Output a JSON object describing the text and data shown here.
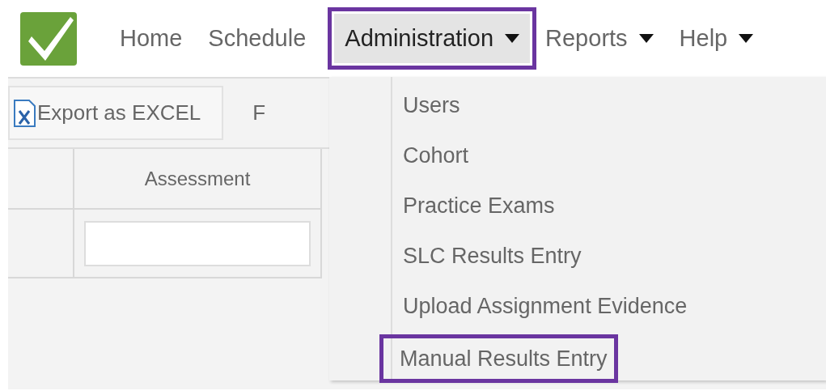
{
  "nav": [
    {
      "label": "Home",
      "has_menu": false,
      "open": false,
      "highlighted": false
    },
    {
      "label": "Schedule",
      "has_menu": false,
      "open": false,
      "highlighted": false
    },
    {
      "label": "Administration",
      "has_menu": true,
      "open": true,
      "highlighted": true
    },
    {
      "label": "Reports",
      "has_menu": true,
      "open": false,
      "highlighted": false
    },
    {
      "label": "Help",
      "has_menu": true,
      "open": false,
      "highlighted": false
    }
  ],
  "toolbar": [
    {
      "kind": "button",
      "label": "Export as EXCEL"
    },
    {
      "kind": "text",
      "label": "F"
    }
  ],
  "table": {
    "columns": [
      {
        "kind": "blank",
        "filter": false
      },
      {
        "kind": "text",
        "label": "Assessment",
        "filter": true
      }
    ]
  },
  "dropdown": {
    "items": [
      {
        "label": "Users",
        "highlighted": false
      },
      {
        "label": "Cohort",
        "highlighted": false
      },
      {
        "label": "Practice Exams",
        "highlighted": false
      },
      {
        "label": "SLC Results Entry",
        "highlighted": false
      },
      {
        "label": "Upload Assignment Evidence",
        "highlighted": false
      },
      {
        "label": "Manual Results Entry",
        "highlighted": true
      }
    ]
  }
}
